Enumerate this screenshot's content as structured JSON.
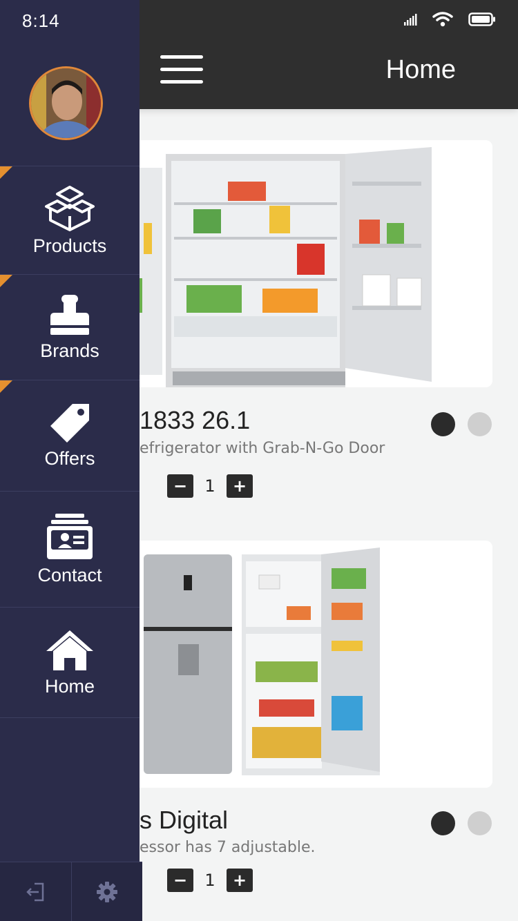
{
  "status": {
    "time": "8:14"
  },
  "header": {
    "title": "Home"
  },
  "products": [
    {
      "title": "1833 26.1",
      "desc": "efrigerator with Grab-N-Go Door",
      "qty": "1",
      "minus": "−",
      "plus": "+"
    },
    {
      "title": "s Digital",
      "desc": "essor has 7 adjustable.",
      "qty": "1",
      "minus": "−",
      "plus": "+"
    }
  ],
  "drawer": {
    "menu": [
      {
        "label": "Products",
        "icon": "box-icon"
      },
      {
        "label": "Brands",
        "icon": "stamp-icon"
      },
      {
        "label": "Offers",
        "icon": "tag-icon"
      },
      {
        "label": "Contact",
        "icon": "contact-card-icon"
      },
      {
        "label": "Home",
        "icon": "home-icon"
      }
    ],
    "bottom": [
      {
        "icon": "logout-icon"
      },
      {
        "icon": "gear-icon"
      }
    ]
  },
  "colors": {
    "drawer": "#2b2c4a",
    "accent": "#e5902f",
    "header": "#2f2f2f"
  }
}
